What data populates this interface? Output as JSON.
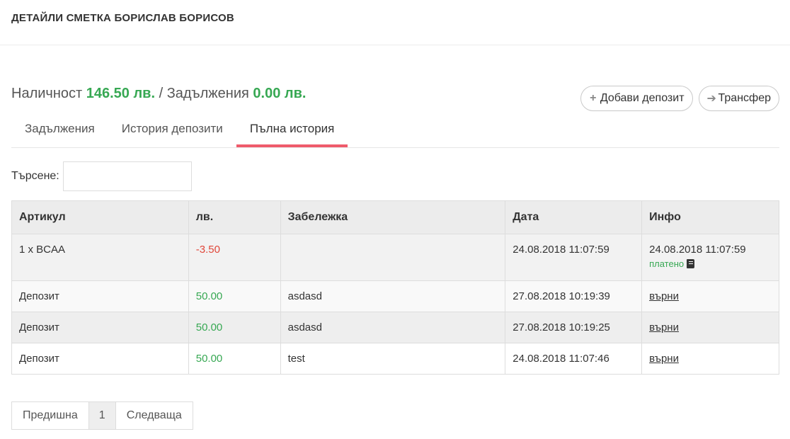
{
  "header": {
    "title": "ДЕТАЙЛИ СМЕТКА БОРИСЛАВ БОРИСОВ"
  },
  "balance": {
    "available_label": "Наличност",
    "available_amount": "146.50 лв.",
    "separator": "/",
    "debts_label": "Задължения",
    "debts_amount": "0.00 лв."
  },
  "actions": {
    "add_deposit": {
      "label": "Добави депозит",
      "icon": "plus-icon"
    },
    "transfer": {
      "label": "Трансфер",
      "icon": "arrow-right-icon"
    }
  },
  "tabs": [
    {
      "label": "Задължения",
      "active": false
    },
    {
      "label": "История депозити",
      "active": false
    },
    {
      "label": "Пълна история",
      "active": true
    }
  ],
  "search": {
    "label": "Търсене:",
    "value": "",
    "placeholder": ""
  },
  "table": {
    "headers": [
      "Артикул",
      "лв.",
      "Забележка",
      "Дата",
      "Инфо"
    ],
    "rows": [
      {
        "item": "1 x BCAA",
        "amount": "-3.50",
        "note": "",
        "date": "24.08.2018 11:07:59",
        "info_date": "24.08.2018 11:07:59",
        "info_status": "платено",
        "info_link": ""
      },
      {
        "item": "Депозит",
        "amount": "50.00",
        "note": "asdasd",
        "date": "27.08.2018 10:19:39",
        "info_link": "върни"
      },
      {
        "item": "Депозит",
        "amount": "50.00",
        "note": "asdasd",
        "date": "27.08.2018 10:19:25",
        "info_link": "върни"
      },
      {
        "item": "Депозит",
        "amount": "50.00",
        "note": "test",
        "date": "24.08.2018 11:07:46",
        "info_link": "върни"
      }
    ]
  },
  "pagination": {
    "prev": "Предишна",
    "current": "1",
    "next": "Следваща"
  },
  "colors": {
    "accent_tab": "#ef5b6b",
    "positive": "#37a853",
    "negative": "#e0473a"
  }
}
